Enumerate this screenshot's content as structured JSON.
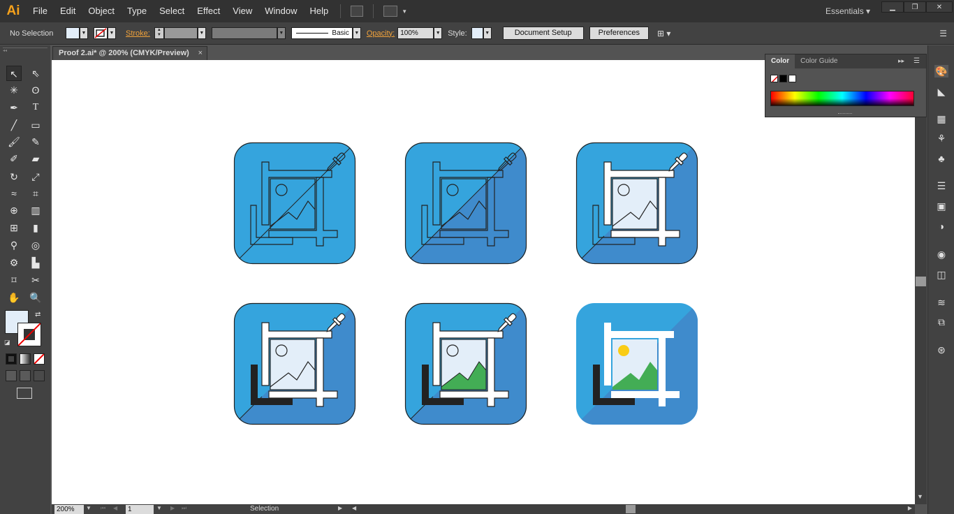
{
  "app": {
    "logo": "Ai",
    "workspace": "Essentials ▾"
  },
  "menu": [
    "File",
    "Edit",
    "Object",
    "Type",
    "Select",
    "Effect",
    "View",
    "Window",
    "Help"
  ],
  "control_bar": {
    "selection": "No Selection",
    "stroke_label": "Stroke:",
    "stroke_style": "Basic",
    "opacity_label": "Opacity:",
    "opacity_value": "100%",
    "style_label": "Style:",
    "document_setup": "Document Setup",
    "preferences": "Preferences"
  },
  "document_tab": {
    "title": "Proof 2.ai* @ 200% (CMYK/Preview)",
    "close": "×"
  },
  "status": {
    "zoom": "200%",
    "page": "1",
    "tool": "Selection"
  },
  "color_panel": {
    "tab_color": "Color",
    "tab_guide": "Color Guide"
  },
  "colors": {
    "tile_blue": "#35a4dd",
    "tile_dark_blue": "#3f8bcc",
    "sky": "#e3eef9",
    "sun": "#f9cc16",
    "hill": "#43ad55",
    "ink": "#222222"
  },
  "artboard_icons": [
    "crop-image-icon-step-1",
    "crop-image-icon-step-2",
    "crop-image-icon-step-3",
    "crop-image-icon-step-4",
    "crop-image-icon-step-5",
    "crop-image-icon-final"
  ]
}
